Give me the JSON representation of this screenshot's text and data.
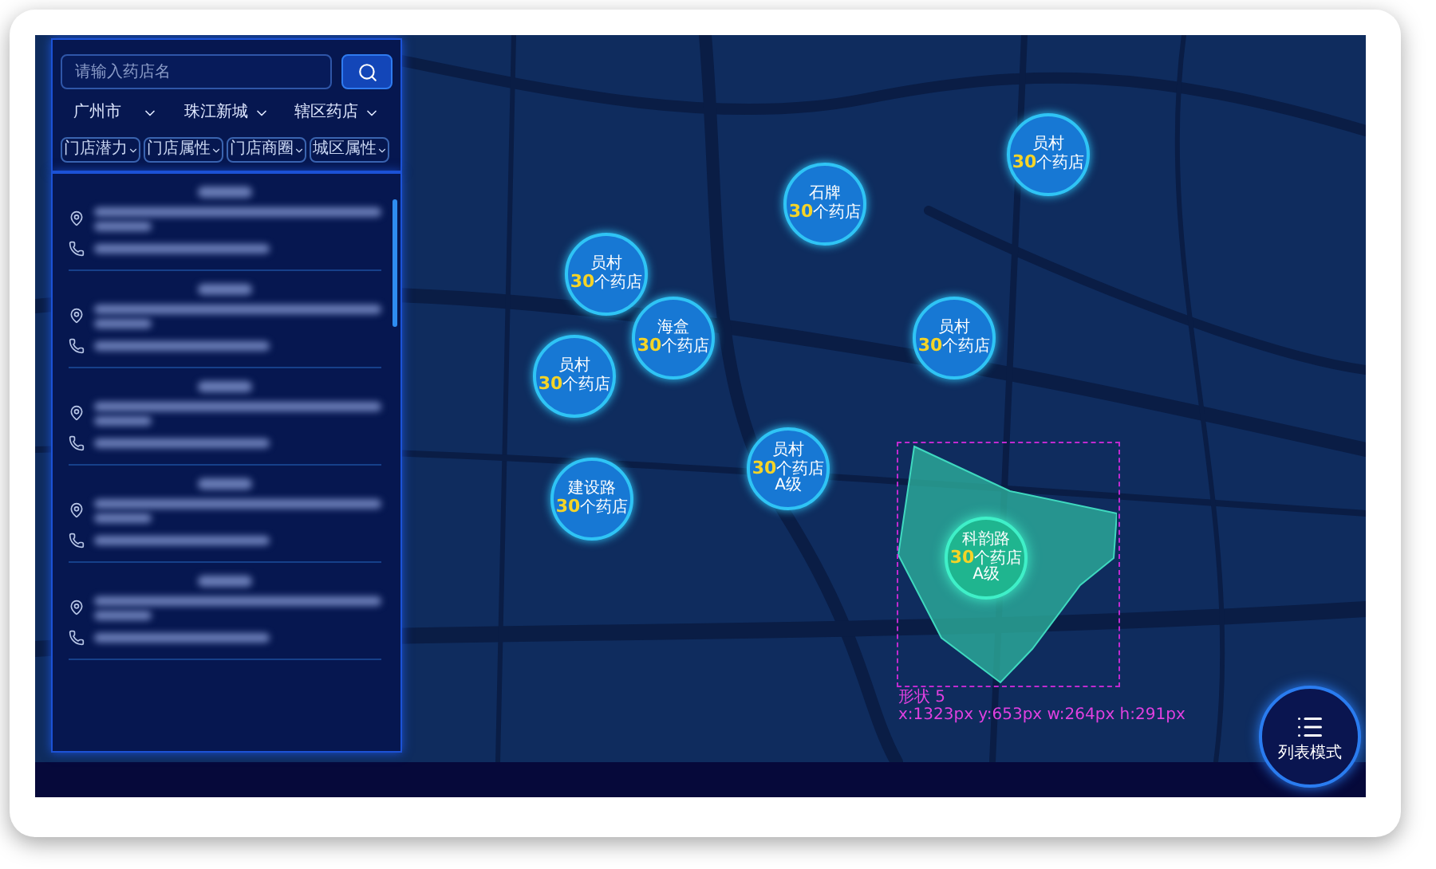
{
  "search": {
    "placeholder": "请输入药店名"
  },
  "filters": [
    {
      "label": "广州市"
    },
    {
      "label": "珠江新城"
    },
    {
      "label": "辖区药店"
    }
  ],
  "sub_filters": [
    {
      "label": "门店潜力"
    },
    {
      "label": "门店属性"
    },
    {
      "label": "门店商圈"
    },
    {
      "label": "城区属性"
    }
  ],
  "store_list": [
    {
      "kind": "blurred"
    },
    {
      "kind": "blurred"
    },
    {
      "kind": "blurred"
    },
    {
      "kind": "blurred"
    },
    {
      "kind": "blurred"
    }
  ],
  "map": {
    "markers": [
      {
        "name": "员村",
        "count": "30",
        "unit": "个药店",
        "selected": false
      },
      {
        "name": "石牌",
        "count": "30",
        "unit": "个药店",
        "selected": false
      },
      {
        "name": "员村",
        "count": "30",
        "unit": "个药店",
        "selected": false
      },
      {
        "name": "海盒",
        "count": "30",
        "unit": "个药店",
        "selected": false
      },
      {
        "name": "员村",
        "count": "30",
        "unit": "个药店",
        "selected": false
      },
      {
        "name": "员村",
        "count": "30",
        "unit": "个药店",
        "selected": false
      },
      {
        "name": "员村",
        "count": "30",
        "unit": "个药店",
        "grade": "A级",
        "selected": false
      },
      {
        "name": "建设路",
        "count": "30",
        "unit": "个药店",
        "selected": false
      },
      {
        "name": "科韵路",
        "count": "30",
        "unit": "个药店",
        "grade": "A级",
        "selected": true
      }
    ],
    "selection_label": {
      "title": "形状 5",
      "geometry": "x:1323px y:653px w:264px h:291px"
    }
  },
  "mode_button": {
    "label": "列表模式"
  }
}
